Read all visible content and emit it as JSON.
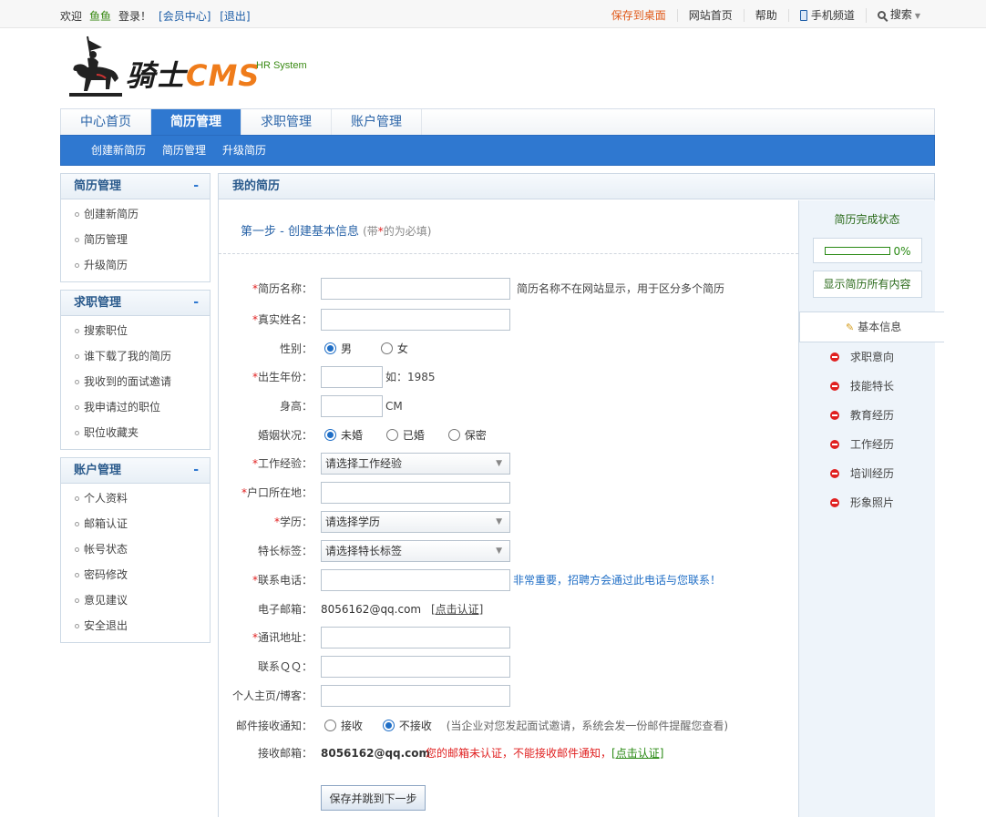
{
  "topbar": {
    "welcome": "欢迎",
    "username": "鱼鱼",
    "login_text": "登录！",
    "member_center": "[会员中心]",
    "logout": "[退出]",
    "save_desktop": "保存到桌面",
    "site_home": "网站首页",
    "help": "帮助",
    "mobile": "手机频道",
    "search": "搜索"
  },
  "logo": {
    "title": "骑士",
    "cms": "CMS",
    "subtitle": "HR System"
  },
  "mainnav": {
    "tabs": [
      {
        "label": "中心首页",
        "active": false
      },
      {
        "label": "简历管理",
        "active": true
      },
      {
        "label": "求职管理",
        "active": false
      },
      {
        "label": "账户管理",
        "active": false
      }
    ]
  },
  "subnav": {
    "items": [
      "创建新简历",
      "简历管理",
      "升级简历"
    ]
  },
  "sidebar": {
    "groups": [
      {
        "title": "简历管理",
        "toggle": "-",
        "items": [
          "创建新简历",
          "简历管理",
          "升级简历"
        ]
      },
      {
        "title": "求职管理",
        "toggle": "-",
        "items": [
          "搜索职位",
          "谁下载了我的简历",
          "我收到的面试邀请",
          "我申请过的职位",
          "职位收藏夹"
        ]
      },
      {
        "title": "账户管理",
        "toggle": "-",
        "items": [
          "个人资料",
          "邮箱认证",
          "帐号状态",
          "密码修改",
          "意见建议",
          "安全退出"
        ]
      }
    ]
  },
  "content": {
    "title": "我的简历",
    "step_title": "第一步 - 创建基本信息",
    "step_note_prefix": "(带",
    "step_note_star": "*",
    "step_note_suffix": "的为必填)",
    "fields": {
      "resume_name": {
        "label": "简历名称：",
        "value": "",
        "tip": "简历名称不在网站显示，用于区分多个简历"
      },
      "real_name": {
        "label": "真实姓名：",
        "value": ""
      },
      "gender": {
        "label": "性别：",
        "options": [
          "男",
          "女"
        ],
        "selected": "男"
      },
      "birth_year": {
        "label": "出生年份：",
        "value": "",
        "tip": "如：1985"
      },
      "height": {
        "label": "身高：",
        "value": "",
        "unit": "CM"
      },
      "marital": {
        "label": "婚姻状况：",
        "options": [
          "未婚",
          "已婚",
          "保密"
        ],
        "selected": "未婚"
      },
      "experience": {
        "label": "工作经验：",
        "value": "请选择工作经验"
      },
      "hukou": {
        "label": "户口所在地：",
        "value": ""
      },
      "education": {
        "label": "学历：",
        "value": "请选择学历"
      },
      "tags": {
        "label": "特长标签：",
        "value": "请选择特长标签"
      },
      "phone": {
        "label": "联系电话：",
        "value": "",
        "tip": "非常重要，招聘方会通过此电话与您联系！"
      },
      "email": {
        "label": "电子邮箱：",
        "value": "8056162@qq.com",
        "action": "[点击认证]"
      },
      "address": {
        "label": "通讯地址：",
        "value": ""
      },
      "qq": {
        "label": "联系ＱＱ：",
        "value": ""
      },
      "homepage": {
        "label": "个人主页/博客：",
        "value": ""
      },
      "mail_notify": {
        "label": "邮件接收通知：",
        "options": [
          "接收",
          "不接收"
        ],
        "selected": "不接收",
        "tip": "(当企业对您发起面试邀请，系统会发一份邮件提醒您查看)"
      },
      "receive_email": {
        "label": "接收邮箱：",
        "value": "8056162@qq.com",
        "warning": "您的邮箱未认证，不能接收邮件通知，",
        "action": "[点击认证]"
      }
    },
    "submit_label": "保存并跳到下一步"
  },
  "status": {
    "title": "简历完成状态",
    "progress_percent": 0,
    "progress_text": "0%",
    "show_all": "显示简历所有内容",
    "steps": [
      {
        "label": "基本信息",
        "current": true
      },
      {
        "label": "求职意向",
        "current": false
      },
      {
        "label": "技能特长",
        "current": false
      },
      {
        "label": "教育经历",
        "current": false
      },
      {
        "label": "工作经历",
        "current": false
      },
      {
        "label": "培训经历",
        "current": false
      },
      {
        "label": "形象照片",
        "current": false
      }
    ]
  }
}
